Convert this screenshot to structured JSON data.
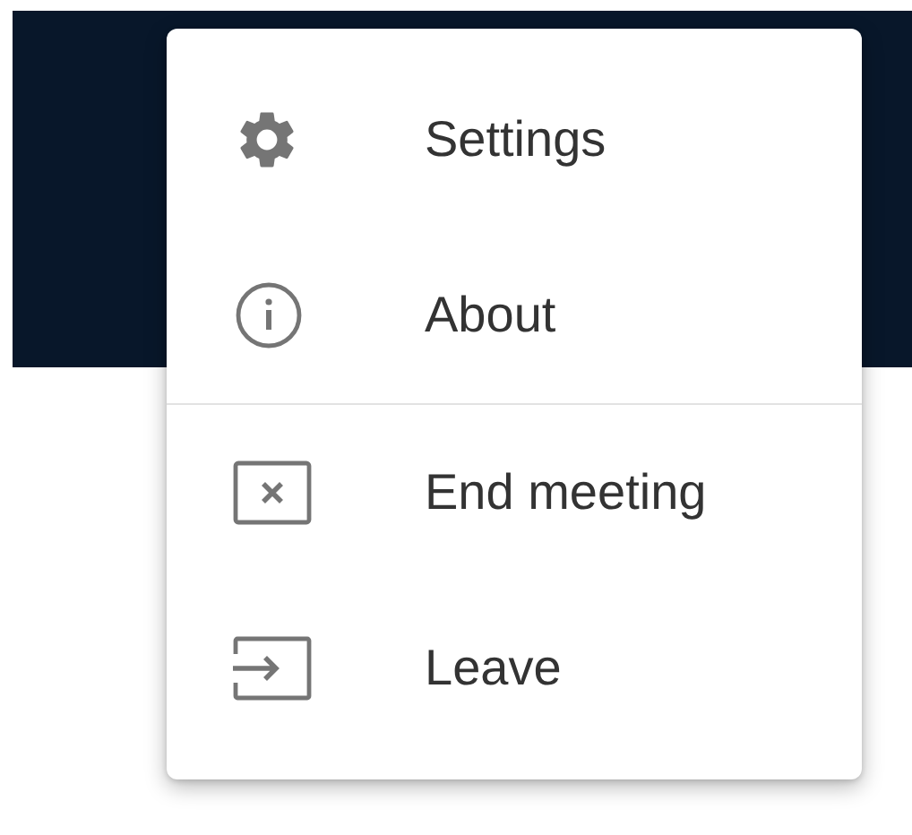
{
  "menu": {
    "sections": [
      {
        "items": [
          {
            "kind": "gear",
            "label": "Settings"
          },
          {
            "kind": "info",
            "label": "About"
          }
        ]
      },
      {
        "items": [
          {
            "kind": "end",
            "label": "End meeting"
          },
          {
            "kind": "leave",
            "label": "Leave"
          }
        ]
      }
    ]
  }
}
